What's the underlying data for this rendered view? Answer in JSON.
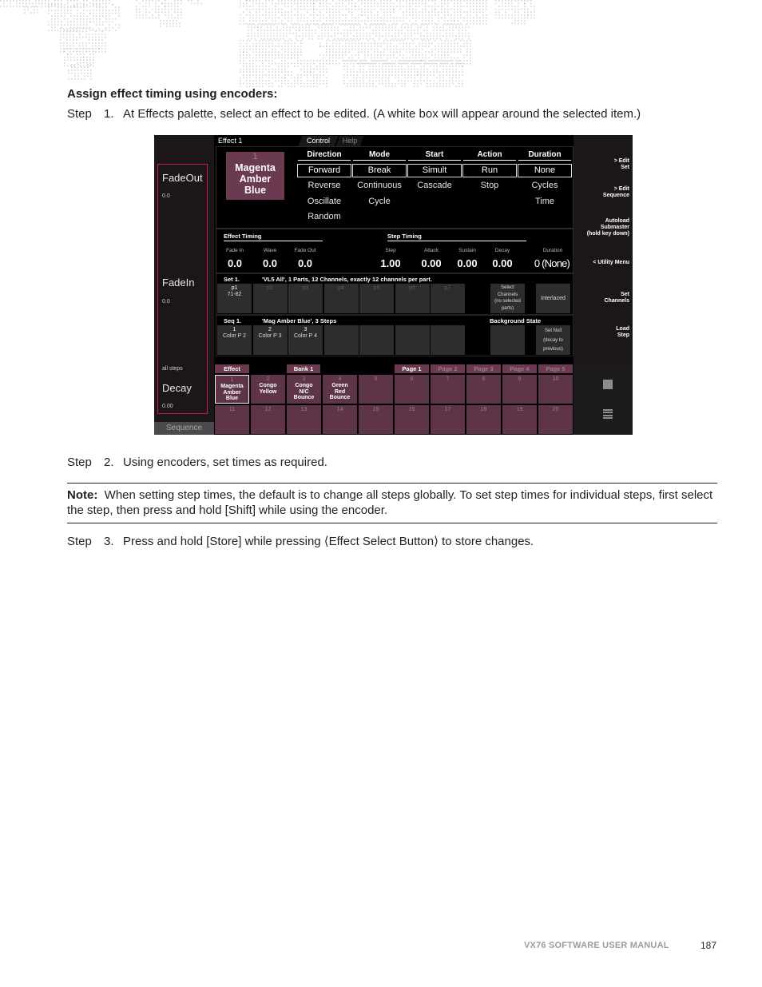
{
  "document": {
    "heading": "Assign effect timing using encoders:",
    "steps": [
      {
        "label": "Step",
        "num": "1.",
        "text": "At Effects palette, select an effect to be edited. (A white box will appear around the selected item.)"
      },
      {
        "label": "Step",
        "num": "2.",
        "text": "Using encoders, set times as required."
      },
      {
        "label": "Step",
        "num": "3.",
        "text": "Press and hold [Store] while pressing ⟨Effect Select Button⟩ to store changes."
      }
    ],
    "note": {
      "label": "Note:",
      "text": "When setting step times, the default is to change all steps globally. To set step times for individual steps, first select the step, then press and hold [Shift] while using the encoder."
    },
    "footer": {
      "title": "VX76 SOFTWARE USER MANUAL",
      "page": "187"
    }
  },
  "console": {
    "encoders": [
      {
        "name": "FadeOut",
        "value": "0.0"
      },
      {
        "name": "FadeIn",
        "value": "0.0"
      },
      {
        "name": "Decay",
        "value": "0.00",
        "scope": "all steps"
      }
    ],
    "bottom_left_tab": "Sequence",
    "header_title": "Effect 1",
    "tabs": [
      "Control",
      "Help"
    ],
    "effect": {
      "number": "1",
      "name_lines": [
        "Magenta",
        "Amber",
        "Blue"
      ]
    },
    "option_columns": [
      {
        "header": "Direction",
        "selected": "Forward",
        "others": [
          "Reverse",
          "Oscillate",
          "Random"
        ]
      },
      {
        "header": "Mode",
        "selected": "Break",
        "others": [
          "Continuous",
          "Cycle"
        ]
      },
      {
        "header": "Start",
        "selected": "Simult",
        "others": [
          "Cascade"
        ]
      },
      {
        "header": "Action",
        "selected": "Run",
        "others": [
          "Stop"
        ]
      },
      {
        "header": "Duration",
        "selected": "None",
        "others": [
          "Cycles",
          "Time"
        ]
      }
    ],
    "effect_timing": {
      "title": "Effect Timing",
      "fields": [
        {
          "label": "Fade In",
          "value": "0.0"
        },
        {
          "label": "Wave",
          "value": "0.0"
        },
        {
          "label": "Fade Out",
          "value": "0.0"
        }
      ]
    },
    "step_timing": {
      "title": "Step Timing",
      "fields": [
        {
          "label": "Step",
          "value": "1.00"
        },
        {
          "label": "Attack",
          "value": "0.00"
        },
        {
          "label": "Sustain",
          "value": "0.00"
        },
        {
          "label": "Decay",
          "value": "0.00"
        },
        {
          "label": "Duration",
          "value": "0 (None)"
        }
      ]
    },
    "set_row": {
      "label": "Set 1.",
      "description": "'VL5 All', 1 Parts, 12 Channels, exactly 12 channels per part.",
      "parts": [
        {
          "name": "p1",
          "detail": "71-82"
        },
        {
          "name": "p2"
        },
        {
          "name": "p3"
        },
        {
          "name": "p4"
        },
        {
          "name": "p5"
        },
        {
          "name": "p6"
        },
        {
          "name": "p7"
        }
      ],
      "select_channels": [
        "Select",
        "Channels",
        "(no selected",
        "parts)"
      ],
      "interlaced": "Interlaced"
    },
    "seq_row": {
      "label": "Seq 1.",
      "description": "'Mag Amber Blue', 3 Steps",
      "steps": [
        {
          "num": "1",
          "name": "Color P 2"
        },
        {
          "num": "2",
          "name": "Color P 3"
        },
        {
          "num": "3",
          "name": "Color P 4"
        }
      ],
      "background_state_label": "Background State",
      "set_null": [
        "Set Null",
        "(decay to",
        "previous)"
      ]
    },
    "palette": {
      "effect_tag": "Effect",
      "bank_tag": "Bank 1",
      "pages": [
        "Page 1",
        "Page 2",
        "Page 3",
        "Page 4",
        "Page 5"
      ],
      "active_page": "Page 1",
      "cells": [
        {
          "num": "1",
          "label": [
            "Magenta",
            "Amber",
            "Blue"
          ],
          "selected": true
        },
        {
          "num": "2",
          "label": [
            "Congo",
            "Yellow"
          ]
        },
        {
          "num": "3",
          "label": [
            "Congo",
            "N/C",
            "Bounce"
          ]
        },
        {
          "num": "4",
          "label": [
            "Green",
            "Red",
            "Bounce"
          ]
        },
        {
          "num": "5"
        },
        {
          "num": "6"
        },
        {
          "num": "7"
        },
        {
          "num": "8"
        },
        {
          "num": "9"
        },
        {
          "num": "10"
        },
        {
          "num": "11"
        },
        {
          "num": "12"
        },
        {
          "num": "13"
        },
        {
          "num": "14"
        },
        {
          "num": "15"
        },
        {
          "num": "16"
        },
        {
          "num": "17"
        },
        {
          "num": "18"
        },
        {
          "num": "19"
        },
        {
          "num": "20"
        }
      ]
    },
    "softkeys": [
      [
        "> Edit",
        "Set"
      ],
      [
        "> Edit",
        "Sequence"
      ],
      [
        "Autoload",
        "Submaster",
        "(hold key down)"
      ],
      [
        "< Utility Menu"
      ],
      [
        "Set",
        "Channels"
      ],
      [
        "Load",
        "Step"
      ]
    ],
    "icons": [
      "stop-square-icon",
      "list-icon"
    ],
    "colors": {
      "palette_cell": "#5e3548",
      "encoder_highlight": "#c8203c",
      "effect_tile": "#6b3a50"
    }
  }
}
